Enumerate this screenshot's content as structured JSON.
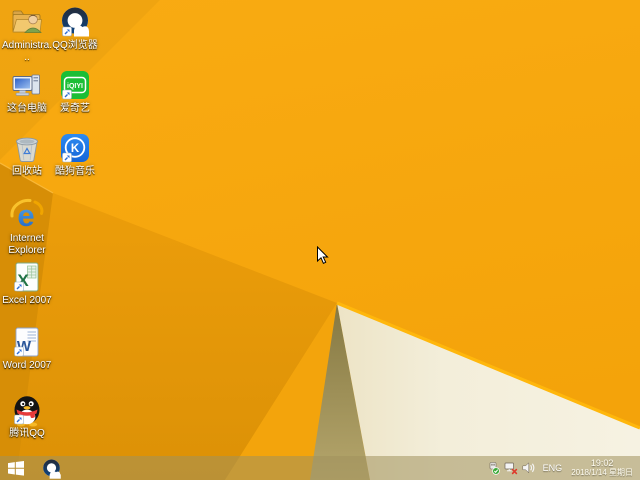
{
  "desktop": {
    "icons": [
      {
        "label": "Administra...",
        "icon": "user-folder-icon"
      },
      {
        "label": "QQ浏览器",
        "icon": "qq-browser-icon"
      },
      {
        "label": "这台电脑",
        "icon": "this-pc-icon"
      },
      {
        "label": "爱奇艺",
        "icon": "iqiyi-icon",
        "icon_text": "iQIYI"
      },
      {
        "label": "回收站",
        "icon": "recycle-bin-icon"
      },
      {
        "label": "酷狗音乐",
        "icon": "kugou-music-icon",
        "icon_text": "K"
      },
      {
        "label": "Internet Explorer",
        "icon": "internet-explorer-icon",
        "icon_text": "e"
      },
      {
        "label": "Excel 2007",
        "icon": "excel-icon",
        "icon_text": "X"
      },
      {
        "label": "Word 2007",
        "icon": "word-icon",
        "icon_text": "W"
      },
      {
        "label": "腾讯QQ",
        "icon": "tencent-qq-icon"
      }
    ]
  },
  "taskbar": {
    "start_button": {
      "icon": "windows-start-icon"
    },
    "pinned": [
      {
        "name": "QQ浏览器",
        "icon": "qq-browser-icon"
      }
    ],
    "tray": {
      "icons": [
        "usb-safely-remove-icon",
        "network-disconnected-icon",
        "volume-icon"
      ],
      "language": "ENG",
      "clock": {
        "time": "19:02",
        "date": "2018/1/14 星期日"
      }
    }
  },
  "colors": {
    "wallpaper_base": "#F8A70D",
    "wallpaper_shade": "#E29409",
    "wallpaper_left_fold": "#D78E06",
    "olive_wedge": "#9A8C4F",
    "cream_panel": "#F3EEDA",
    "fold_highlight": "#FFB70C",
    "iqiyi_green": "#1CBE36",
    "kugou_blue": "#1F7FE8",
    "qq_scarf_red": "#E63A3A",
    "ie_blue": "#2B7CD8",
    "excel_green": "#217346",
    "word_blue": "#2B579A"
  }
}
